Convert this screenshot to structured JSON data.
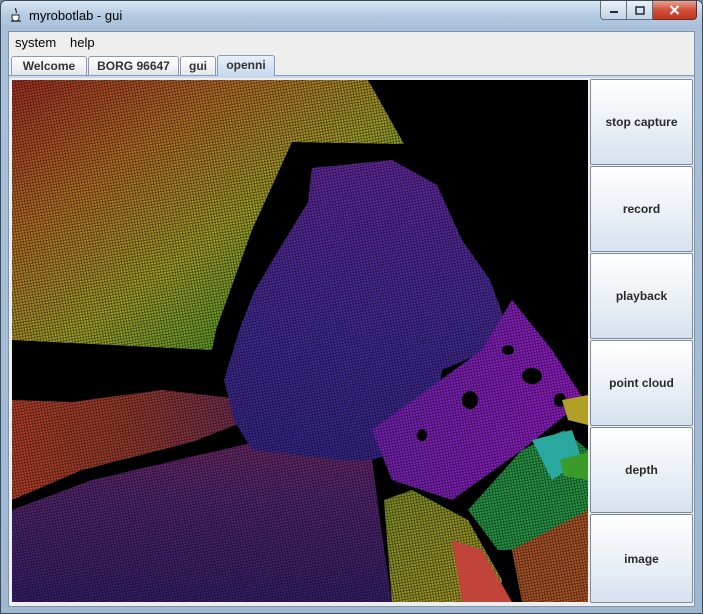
{
  "window": {
    "title": "myrobotlab - gui",
    "icon": "java-cup-icon",
    "controls": {
      "minimize": "minimize-icon",
      "maximize": "maximize-icon",
      "close": "close-icon"
    }
  },
  "menubar": {
    "items": [
      "system",
      "help"
    ]
  },
  "tabs": {
    "items": [
      "Welcome",
      "BORG 96647",
      "gui",
      "openni"
    ],
    "active": "openni"
  },
  "openni": {
    "view": "point-cloud-depth-render",
    "buttons": [
      "stop capture",
      "record",
      "playback",
      "point cloud",
      "depth",
      "image"
    ]
  },
  "colors": {
    "window_frame": "#a9c1da",
    "close_button": "#c13620",
    "panel_background": "#eeeeee",
    "render_background": "#000000"
  }
}
